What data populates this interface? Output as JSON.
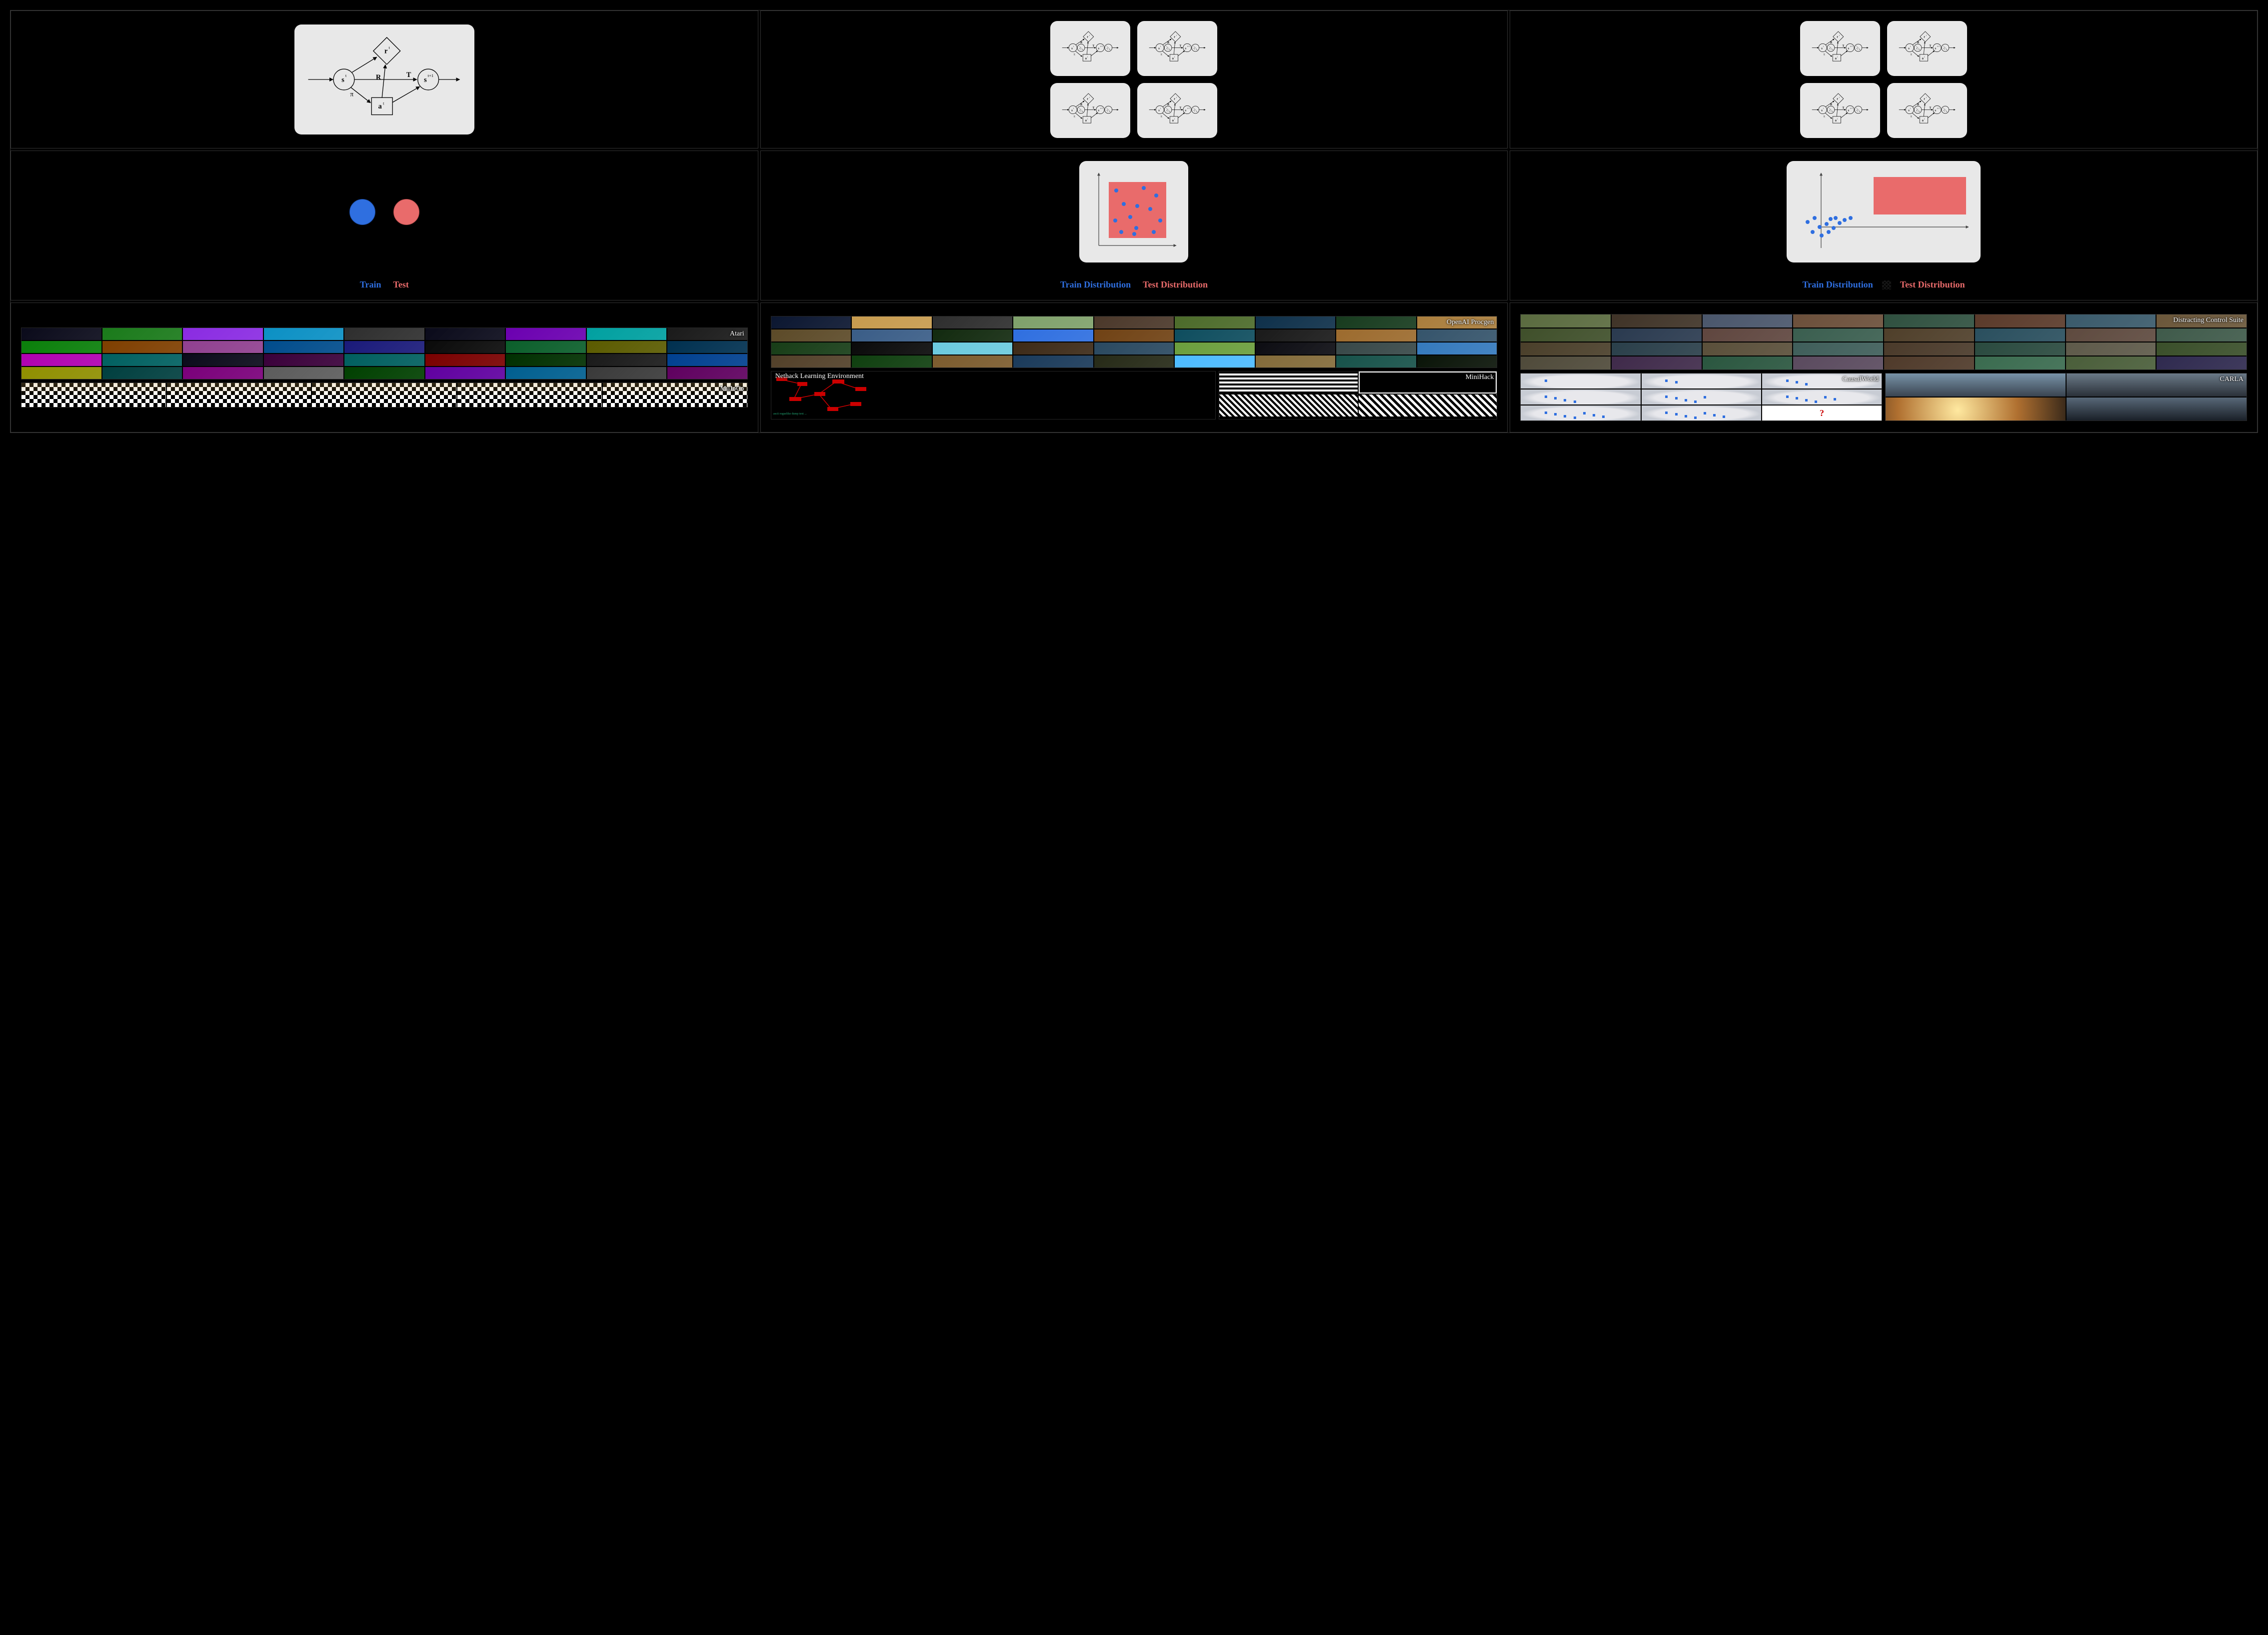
{
  "mdp_nodes": {
    "s": "s",
    "s_exp": "t",
    "snext": "s",
    "snext_exp": "t+1",
    "a": "a",
    "a_exp": "t",
    "r": "r",
    "r_exp": "t",
    "pi": "π",
    "R": "R",
    "T": "T"
  },
  "mdp_ctx_nodes": {
    "s": "s",
    "s_exp": "t",
    "cs": "c",
    "cs_sub": "s",
    "cr": "c",
    "cr_sub": "r",
    "snext": "s",
    "snext_exp": "t+1",
    "a": "a",
    "a_exp": "t",
    "r": "r",
    "r_exp": "t",
    "pi": "π",
    "R": "R",
    "T": "T"
  },
  "row2_labels": {
    "col1_train": "Train",
    "col1_test": "Test",
    "col2_train": "Train Distribution",
    "col2_test": "Test Distribution",
    "col3_train": "Train Distribution",
    "col3_test": "Test Distribution"
  },
  "row3": {
    "col1": {
      "atari": "Atari",
      "mujoco": "MuJoCo"
    },
    "col2": {
      "procgen": "OpenAI Procgen",
      "nethack": "Nethack Learning Environment",
      "minihack": "MiniHack"
    },
    "col3": {
      "dcs": "Distracting Control Suite",
      "causal": "CausalWorld",
      "carla": "CARLA"
    }
  },
  "atari_colors": [
    "#0a0a1a",
    "#1a7a1a",
    "#8a2be2",
    "#0b90c4",
    "#2e2e2e",
    "#0a0a1a",
    "#6b00b0",
    "#00a0a0",
    "#1a1a1a",
    "#0a7f0a",
    "#7f3f00",
    "#904090",
    "#004c8c",
    "#1a1a7a",
    "#0a0a0a",
    "#0b5f2b",
    "#5b5b00",
    "#003050",
    "#b000b0",
    "#006060",
    "#0a0a1a",
    "#3a003a",
    "#005f5f",
    "#7a0000",
    "#002f00",
    "#1a1a1a",
    "#004090",
    "#8f8f00",
    "#003f3f",
    "#7a007a",
    "#5c5c5c",
    "#004000",
    "#6000a0",
    "#005f90",
    "#3a3a3a",
    "#5f005f"
  ],
  "procgen_colors": [
    "#0b1630",
    "#c79b4e",
    "#2e2e2e",
    "#7fa16b",
    "#4b382a",
    "#4c6b2a",
    "#0e304a",
    "#173b1e",
    "#aa7e3d",
    "#5c4a28",
    "#3a5d87",
    "#122a0f",
    "#2f6fe0",
    "#704214",
    "#0e4d5e",
    "#1a1a1a",
    "#9c6b2e",
    "#35546b",
    "#173d17",
    "#0a0a0a",
    "#6bcade",
    "#3d2a17",
    "#2a4960",
    "#6b9e3d",
    "#0c0c12",
    "#384848",
    "#357abd",
    "#524029",
    "#0f3f0f",
    "#7c5c2e",
    "#1a3a5a",
    "#262a17",
    "#4dbbff",
    "#836b3a",
    "#17524a",
    "#0a1408"
  ],
  "dcs_colors": [
    "#5a6b3f",
    "#3f3327",
    "#4a566b",
    "#6b4f3a",
    "#2f503f",
    "#5a3a2a",
    "#3a5a6b",
    "#6b573a",
    "#3f4f2a",
    "#2a3a4f",
    "#5f463f",
    "#3a5e4f",
    "#4f3f2a",
    "#2a4f5e",
    "#5e4a3f",
    "#3f5a4a",
    "#4a3f2a",
    "#2a3f4a",
    "#5a4f3a",
    "#3f5e5a",
    "#4a3a2a",
    "#2a4a3f",
    "#5e5a4a",
    "#3a4f2a",
    "#4f4a3a",
    "#3f2a4a",
    "#2a563f",
    "#5a4a5e",
    "#4f3a2a",
    "#3a6b4f",
    "#4a5e3a",
    "#2f2a4f"
  ]
}
